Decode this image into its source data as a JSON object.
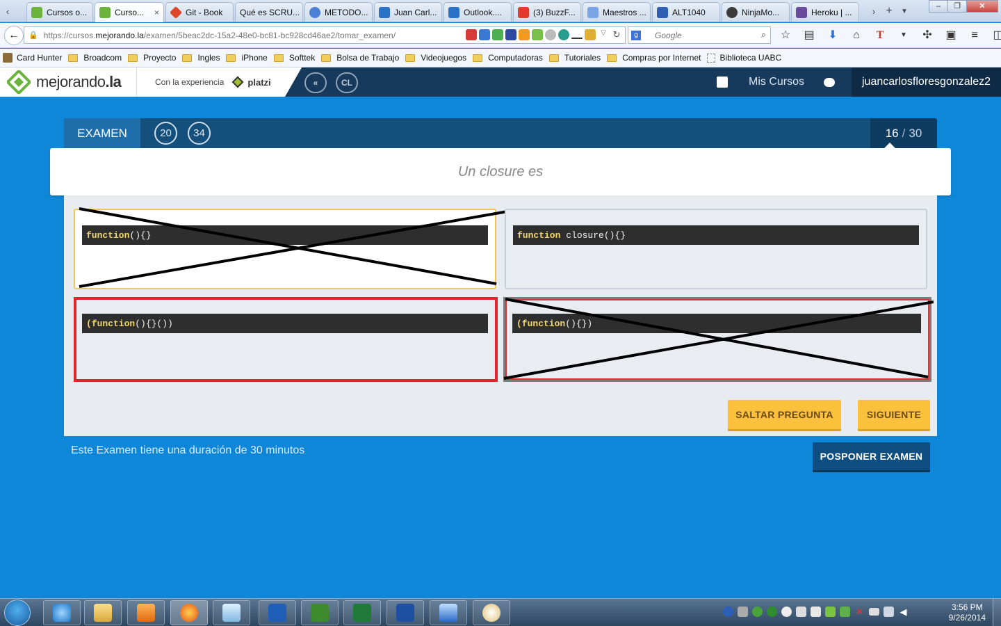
{
  "browser": {
    "tabs": [
      {
        "label": "Cursos o...",
        "active": false,
        "icon_color": "#6bb33c"
      },
      {
        "label": "Curso...",
        "active": true,
        "icon_color": "#6bb33c"
      },
      {
        "label": "Git - Book",
        "active": false,
        "icon_color": "#e0452a"
      },
      {
        "label": "Qué es SCRU...",
        "active": false,
        "icon_color": ""
      },
      {
        "label": "METODO...",
        "active": false,
        "icon_color": "#4c7fd6"
      },
      {
        "label": "Juan Carl...",
        "active": false,
        "icon_color": "#2a72c5"
      },
      {
        "label": "Outlook....",
        "active": false,
        "icon_color": "#2a72c5"
      },
      {
        "label": "(3) BuzzF...",
        "active": false,
        "icon_color": "#e23a2c"
      },
      {
        "label": "Maestros ...",
        "active": false,
        "icon_color": "#7aa4e6"
      },
      {
        "label": "ALT1040",
        "active": false,
        "icon_color": "#2f5fb3"
      },
      {
        "label": "NinjaMo...",
        "active": false,
        "icon_color": "#3a3a3a"
      },
      {
        "label": "Heroku | ...",
        "active": false,
        "icon_color": "#6a4a9a"
      }
    ],
    "tab_close_glyph": "×",
    "new_tab_glyph": "+",
    "url_host_prefix": "https://cursos.",
    "url_host": "mejorando.la",
    "url_path": "/examen/5beac2dc-15a2-48e0-bc81-bc928cd46ae2/tomar_examen/",
    "search_placeholder": "Google",
    "bookmarks": [
      {
        "label": "Card Hunter",
        "type": "app"
      },
      {
        "label": "Broadcom",
        "type": "folder"
      },
      {
        "label": "Proyecto",
        "type": "folder"
      },
      {
        "label": "Ingles",
        "type": "folder"
      },
      {
        "label": "iPhone",
        "type": "folder"
      },
      {
        "label": "Softtek",
        "type": "folder"
      },
      {
        "label": "Bolsa de Trabajo",
        "type": "folder"
      },
      {
        "label": "Videojuegos",
        "type": "folder"
      },
      {
        "label": "Computadoras",
        "type": "folder"
      },
      {
        "label": "Tutoriales",
        "type": "folder"
      },
      {
        "label": "Compras por Internet",
        "type": "folder"
      },
      {
        "label": "Biblioteca UABC",
        "type": "page"
      }
    ]
  },
  "site": {
    "logo_prefix": "mejorando",
    "logo_suffix": ".la",
    "experience_label": "Con la experiencia",
    "partner": "platzi",
    "nav_circle_1": "«",
    "nav_circle_2": "CL",
    "mis_cursos": "Mis Cursos",
    "username": "juancarlosfloresgonzalez2"
  },
  "exam": {
    "label": "EXAMEN",
    "timer_minutes": "20",
    "timer_seconds": "34",
    "current": "16",
    "separator": "/",
    "total": "30",
    "question": "Un closure es",
    "answers": [
      {
        "kw": "function",
        "rest": "(){}",
        "state": "selected-crossed"
      },
      {
        "kw": "function",
        "rest": " closure(){}",
        "state": "normal"
      },
      {
        "kw": "(function",
        "rest": "(){}())",
        "state": "wrong"
      },
      {
        "kw": "(function",
        "rest": "(){})",
        "state": "wrong-crossed"
      }
    ],
    "skip_button": "SALTAR PREGUNTA",
    "next_button": "SIGUIENTE",
    "postpone_button": "POSPONER EXAMEN",
    "duration_text": "Este Examen tiene una duración de 30 minutos"
  },
  "taskbar": {
    "clock_time": "3:56 PM",
    "clock_date": "9/26/2014",
    "apps": [
      "ie-icon",
      "explorer-icon",
      "media-player-icon",
      "firefox-icon",
      "notepad-icon",
      "lync-icon",
      "project-icon",
      "excel-icon",
      "word-icon",
      "remote-desktop-icon",
      "paint-icon"
    ]
  },
  "colors": {
    "page_bg": "#0f87d8",
    "header_bg": "#16395c",
    "accent_yellow": "#fbc13d",
    "wrong_red": "#e0262c"
  }
}
